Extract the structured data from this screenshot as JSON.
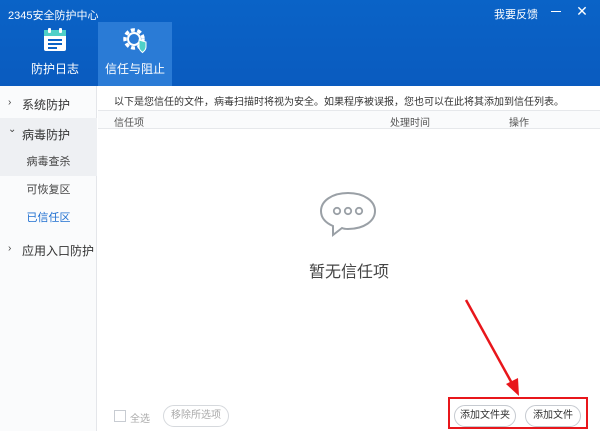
{
  "window": {
    "title": "2345安全防护中心",
    "feedback": "我要反馈",
    "close_glyph": "✕"
  },
  "nav": {
    "tabs": [
      {
        "label": "防护日志",
        "icon": "log-icon"
      },
      {
        "label": "信任与阻止",
        "icon": "gear-shield-icon"
      }
    ]
  },
  "sidebar": {
    "items": [
      {
        "label": "系统防护",
        "chevron": "›"
      },
      {
        "label": "病毒防护",
        "chevron": "⌄"
      },
      {
        "label": "应用入口防护",
        "chevron": "›"
      }
    ],
    "subitems": [
      "病毒查杀",
      "可恢复区",
      "已信任区"
    ]
  },
  "main": {
    "notice": "以下是您信任的文件，病毒扫描时将视为安全。如果程序被误报，您也可以在此将其添加到信任列表。",
    "columns": [
      "信任项",
      "处理时间",
      "操作"
    ],
    "empty_text": "暂无信任项"
  },
  "footer": {
    "select_all": "全选",
    "remove": "移除所选项",
    "add_folder": "添加文件夹",
    "add_file": "添加文件"
  },
  "colors": {
    "header_bg": "#0a5bbf",
    "active_tab": "#2a7bd6",
    "selected_text": "#1f6fd0",
    "annotation": "#e8161b"
  }
}
